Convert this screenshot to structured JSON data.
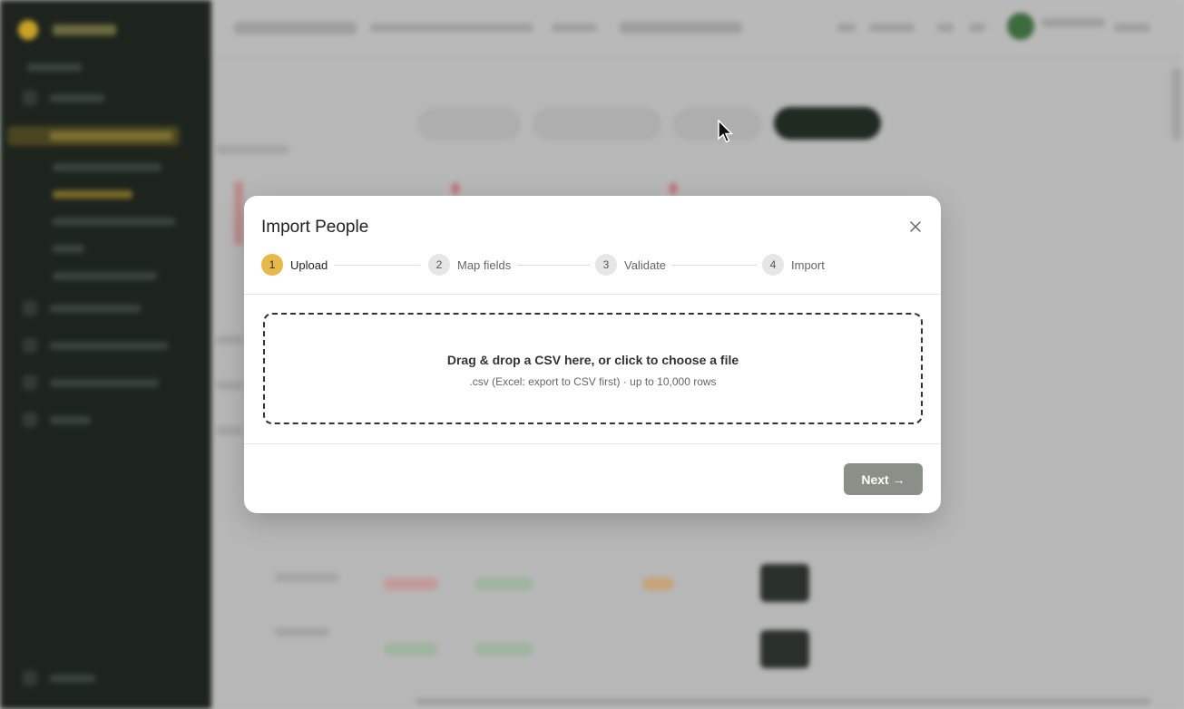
{
  "modal": {
    "title": "Import People",
    "steps": [
      {
        "number": "1",
        "label": "Upload",
        "state": "active"
      },
      {
        "number": "2",
        "label": "Map fields",
        "state": "pending"
      },
      {
        "number": "3",
        "label": "Validate",
        "state": "pending"
      },
      {
        "number": "4",
        "label": "Import",
        "state": "pending"
      }
    ],
    "dropzone": {
      "primary_text": "Drag & drop a CSV here, or click to choose a file",
      "secondary_text": ".csv (Excel: export to CSV first) · up to 10,000 rows"
    },
    "next_button": "Next →",
    "close_icon": "close-icon"
  },
  "colors": {
    "active_step": "#e6b94a",
    "next_button_disabled": "#8a9088",
    "sidebar_bg": "#1d241e"
  }
}
